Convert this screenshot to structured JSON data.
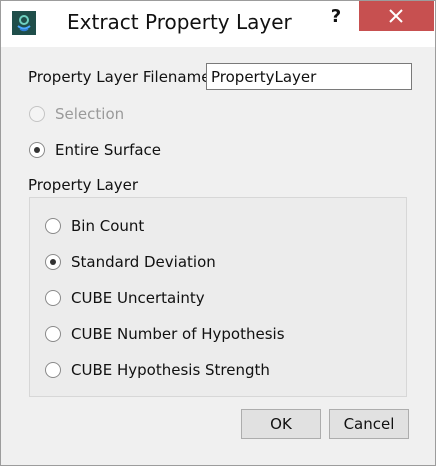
{
  "window": {
    "title": "Extract Property Layer",
    "help_label": "?",
    "icons": {
      "app": "app-logo-icon",
      "close": "close-icon"
    },
    "colors": {
      "close_bg": "#c75050",
      "app_icon_bg": "#1f4e4a"
    }
  },
  "filename": {
    "label": "Property Layer Filename",
    "value": "PropertyLayer"
  },
  "source": {
    "options": [
      {
        "label": "Selection",
        "checked": false,
        "enabled": false
      },
      {
        "label": "Entire Surface",
        "checked": true,
        "enabled": true
      }
    ]
  },
  "property_layer": {
    "title": "Property Layer",
    "options": [
      {
        "label": "Bin Count",
        "checked": false
      },
      {
        "label": "Standard Deviation",
        "checked": true
      },
      {
        "label": "CUBE Uncertainty",
        "checked": false
      },
      {
        "label": "CUBE Number of Hypothesis",
        "checked": false
      },
      {
        "label": "CUBE Hypothesis Strength",
        "checked": false
      }
    ]
  },
  "buttons": {
    "ok": "OK",
    "cancel": "Cancel"
  }
}
